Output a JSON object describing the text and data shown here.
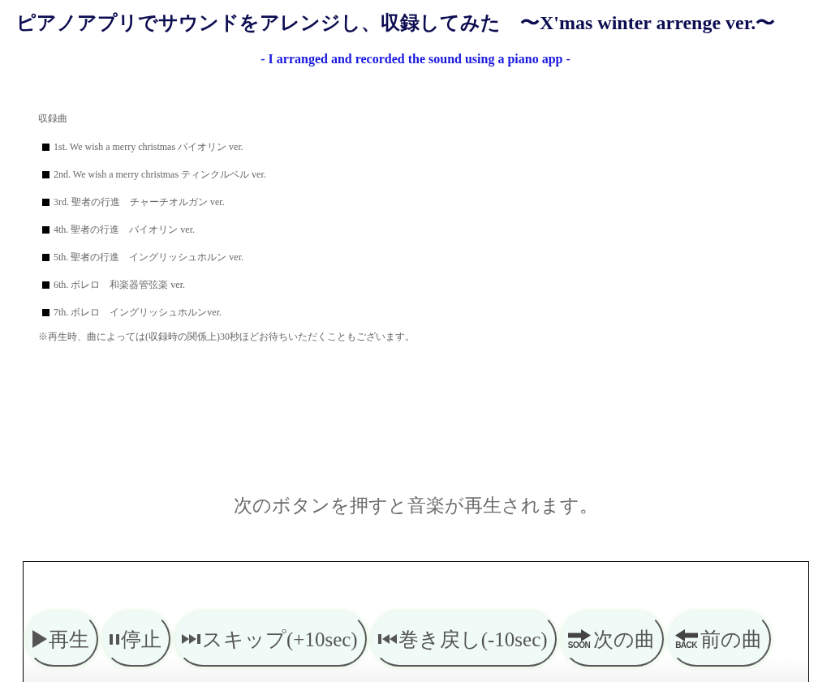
{
  "header": {
    "title": "ピアノアプリでサウンドをアレンジし、収録してみた　〜X'mas winter arrenge ver.〜",
    "subtitle": "- I arranged and recorded the sound using a piano app -"
  },
  "tracklist": {
    "heading": "収録曲",
    "items": [
      "1st. We wish a merry christmas バイオリン ver.",
      "2nd. We wish a merry christmas ティンクルベル ver.",
      "3rd. 聖者の行進　チャーチオルガン ver.",
      "4th. 聖者の行進　バイオリン ver.",
      "5th. 聖者の行進　イングリッシュホルン ver.",
      "6th. ボレロ　和楽器管弦楽 ver.",
      "7th. ボレロ　イングリッシュホルンver."
    ],
    "note": "※再生時、曲によっては(収録時の関係上)30秒ほどお待ちいただくこともございます。"
  },
  "player": {
    "instruction": "次のボタンを押すと音楽が再生されます。",
    "buttons": [
      {
        "kind": "play",
        "label": "再生"
      },
      {
        "kind": "pause",
        "label": "停止"
      },
      {
        "kind": "skip",
        "label": "スキップ(+10sec)"
      },
      {
        "kind": "rewind",
        "label": "巻き戻し(-10sec)"
      },
      {
        "kind": "next",
        "label": "次の曲",
        "caption": "SOON"
      },
      {
        "kind": "previous",
        "label": "前の曲",
        "caption": "BACK"
      }
    ]
  }
}
